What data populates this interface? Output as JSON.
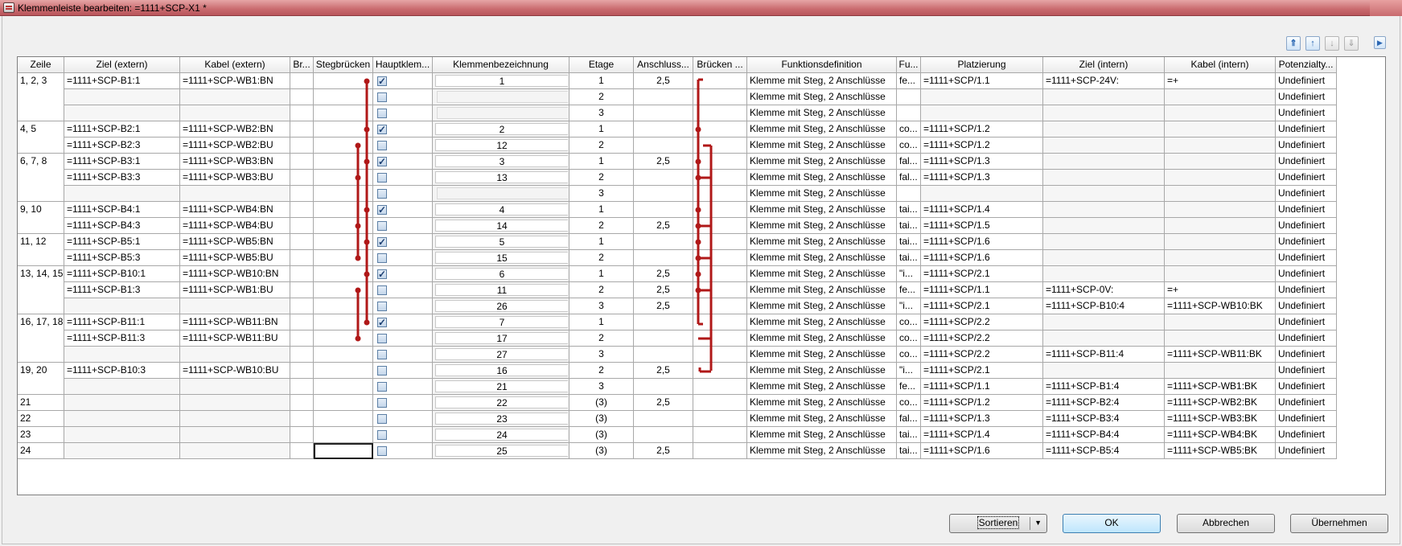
{
  "window": {
    "title": "Klemmenleiste bearbeiten: =1111+SCP-X1 *"
  },
  "nav_buttons": [
    {
      "icon": "move-top-icon",
      "glyph": "⇑"
    },
    {
      "icon": "move-up-icon",
      "glyph": "↑"
    },
    {
      "icon": "move-down-icon",
      "glyph": "↓"
    },
    {
      "icon": "move-bottom-icon",
      "glyph": "⇓"
    },
    {
      "icon": "play-icon",
      "glyph": "▶"
    }
  ],
  "columns": [
    "Zeile",
    "Ziel (extern)",
    "Kabel (extern)",
    "Br...",
    "Stegbrücken",
    "Hauptklem...",
    "Klemmenbezeichnung",
    "Etage",
    "Anschluss...",
    "Brücken ...",
    "Funktionsdefinition",
    "Fu...",
    "Platzierung",
    "Ziel (intern)",
    "Kabel (intern)",
    "Potenzialty..."
  ],
  "zeile_groups": [
    {
      "label": "1, 2, 3",
      "rows": 3
    },
    {
      "label": "4, 5",
      "rows": 2
    },
    {
      "label": "6, 7, 8",
      "rows": 3
    },
    {
      "label": "9, 10",
      "rows": 2
    },
    {
      "label": "11, 12",
      "rows": 2
    },
    {
      "label": "13, 14, 15",
      "rows": 3
    },
    {
      "label": "16, 17, 18",
      "rows": 3
    },
    {
      "label": "19, 20",
      "rows": 2
    },
    {
      "label": "21",
      "rows": 1
    },
    {
      "label": "22",
      "rows": 1
    },
    {
      "label": "23",
      "rows": 1
    },
    {
      "label": "24",
      "rows": 1
    }
  ],
  "rows": [
    {
      "ziel_ext": "=1111+SCP-B1:1",
      "kabel_ext": "=1111+SCP-WB1:BN",
      "haupt": true,
      "klemme": "1",
      "etage": "1",
      "anschluss": "2,5",
      "funktion": "Klemme mit Steg, 2 Anschlüsse",
      "fu": "fe...",
      "platz": "=1111+SCP/1.1",
      "ziel_int": "=1111+SCP-24V:",
      "kabel_int": "=+",
      "pot": "Undefiniert"
    },
    {
      "ziel_ext": "",
      "kabel_ext": "",
      "haupt": false,
      "klemme": "",
      "etage": "2",
      "anschluss": "",
      "funktion": "Klemme mit Steg, 2 Anschlüsse",
      "fu": "",
      "platz": "",
      "ziel_int": "",
      "kabel_int": "",
      "pot": "Undefiniert"
    },
    {
      "ziel_ext": "",
      "kabel_ext": "",
      "haupt": false,
      "klemme": "",
      "etage": "3",
      "anschluss": "",
      "funktion": "Klemme mit Steg, 2 Anschlüsse",
      "fu": "",
      "platz": "",
      "ziel_int": "",
      "kabel_int": "",
      "pot": "Undefiniert"
    },
    {
      "ziel_ext": "=1111+SCP-B2:1",
      "kabel_ext": "=1111+SCP-WB2:BN",
      "haupt": true,
      "klemme": "2",
      "etage": "1",
      "anschluss": "",
      "funktion": "Klemme mit Steg, 2 Anschlüsse",
      "fu": "co...",
      "platz": "=1111+SCP/1.2",
      "ziel_int": "",
      "kabel_int": "",
      "pot": "Undefiniert"
    },
    {
      "ziel_ext": "=1111+SCP-B2:3",
      "kabel_ext": "=1111+SCP-WB2:BU",
      "haupt": false,
      "klemme": "12",
      "etage": "2",
      "anschluss": "",
      "funktion": "Klemme mit Steg, 2 Anschlüsse",
      "fu": "co...",
      "platz": "=1111+SCP/1.2",
      "ziel_int": "",
      "kabel_int": "",
      "pot": "Undefiniert"
    },
    {
      "ziel_ext": "=1111+SCP-B3:1",
      "kabel_ext": "=1111+SCP-WB3:BN",
      "haupt": true,
      "klemme": "3",
      "etage": "1",
      "anschluss": "2,5",
      "funktion": "Klemme mit Steg, 2 Anschlüsse",
      "fu": "fal...",
      "platz": "=1111+SCP/1.3",
      "ziel_int": "",
      "kabel_int": "",
      "pot": "Undefiniert"
    },
    {
      "ziel_ext": "=1111+SCP-B3:3",
      "kabel_ext": "=1111+SCP-WB3:BU",
      "haupt": false,
      "klemme": "13",
      "etage": "2",
      "anschluss": "",
      "funktion": "Klemme mit Steg, 2 Anschlüsse",
      "fu": "fal...",
      "platz": "=1111+SCP/1.3",
      "ziel_int": "",
      "kabel_int": "",
      "pot": "Undefiniert"
    },
    {
      "ziel_ext": "",
      "kabel_ext": "",
      "haupt": false,
      "klemme": "",
      "etage": "3",
      "anschluss": "",
      "funktion": "Klemme mit Steg, 2 Anschlüsse",
      "fu": "",
      "platz": "",
      "ziel_int": "",
      "kabel_int": "",
      "pot": "Undefiniert"
    },
    {
      "ziel_ext": "=1111+SCP-B4:1",
      "kabel_ext": "=1111+SCP-WB4:BN",
      "haupt": true,
      "klemme": "4",
      "etage": "1",
      "anschluss": "",
      "funktion": "Klemme mit Steg, 2 Anschlüsse",
      "fu": "tai...",
      "platz": "=1111+SCP/1.4",
      "ziel_int": "",
      "kabel_int": "",
      "pot": "Undefiniert"
    },
    {
      "ziel_ext": "=1111+SCP-B4:3",
      "kabel_ext": "=1111+SCP-WB4:BU",
      "haupt": false,
      "klemme": "14",
      "etage": "2",
      "anschluss": "2,5",
      "funktion": "Klemme mit Steg, 2 Anschlüsse",
      "fu": "tai...",
      "platz": "=1111+SCP/1.5",
      "ziel_int": "",
      "kabel_int": "",
      "pot": "Undefiniert"
    },
    {
      "ziel_ext": "=1111+SCP-B5:1",
      "kabel_ext": "=1111+SCP-WB5:BN",
      "haupt": true,
      "klemme": "5",
      "etage": "1",
      "anschluss": "",
      "funktion": "Klemme mit Steg, 2 Anschlüsse",
      "fu": "tai...",
      "platz": "=1111+SCP/1.6",
      "ziel_int": "",
      "kabel_int": "",
      "pot": "Undefiniert"
    },
    {
      "ziel_ext": "=1111+SCP-B5:3",
      "kabel_ext": "=1111+SCP-WB5:BU",
      "haupt": false,
      "klemme": "15",
      "etage": "2",
      "anschluss": "",
      "funktion": "Klemme mit Steg, 2 Anschlüsse",
      "fu": "tai...",
      "platz": "=1111+SCP/1.6",
      "ziel_int": "",
      "kabel_int": "",
      "pot": "Undefiniert"
    },
    {
      "ziel_ext": "=1111+SCP-B10:1",
      "kabel_ext": "=1111+SCP-WB10:BN",
      "haupt": true,
      "klemme": "6",
      "etage": "1",
      "anschluss": "2,5",
      "funktion": "Klemme mit Steg, 2 Anschlüsse",
      "fu": "\"i...",
      "platz": "=1111+SCP/2.1",
      "ziel_int": "",
      "kabel_int": "",
      "pot": "Undefiniert"
    },
    {
      "ziel_ext": "=1111+SCP-B1:3",
      "kabel_ext": "=1111+SCP-WB1:BU",
      "haupt": false,
      "klemme": "11",
      "etage": "2",
      "anschluss": "2,5",
      "funktion": "Klemme mit Steg, 2 Anschlüsse",
      "fu": "fe...",
      "platz": "=1111+SCP/1.1",
      "ziel_int": "=1111+SCP-0V:",
      "kabel_int": "=+",
      "pot": "Undefiniert"
    },
    {
      "ziel_ext": "",
      "kabel_ext": "",
      "haupt": false,
      "klemme": "26",
      "etage": "3",
      "anschluss": "2,5",
      "funktion": "Klemme mit Steg, 2 Anschlüsse",
      "fu": "\"i...",
      "platz": "=1111+SCP/2.1",
      "ziel_int": "=1111+SCP-B10:4",
      "kabel_int": "=1111+SCP-WB10:BK",
      "pot": "Undefiniert"
    },
    {
      "ziel_ext": "=1111+SCP-B11:1",
      "kabel_ext": "=1111+SCP-WB11:BN",
      "haupt": true,
      "klemme": "7",
      "etage": "1",
      "anschluss": "",
      "funktion": "Klemme mit Steg, 2 Anschlüsse",
      "fu": "co...",
      "platz": "=1111+SCP/2.2",
      "ziel_int": "",
      "kabel_int": "",
      "pot": "Undefiniert"
    },
    {
      "ziel_ext": "=1111+SCP-B11:3",
      "kabel_ext": "=1111+SCP-WB11:BU",
      "haupt": false,
      "klemme": "17",
      "etage": "2",
      "anschluss": "",
      "funktion": "Klemme mit Steg, 2 Anschlüsse",
      "fu": "co...",
      "platz": "=1111+SCP/2.2",
      "ziel_int": "",
      "kabel_int": "",
      "pot": "Undefiniert"
    },
    {
      "ziel_ext": "",
      "kabel_ext": "",
      "haupt": false,
      "klemme": "27",
      "etage": "3",
      "anschluss": "",
      "funktion": "Klemme mit Steg, 2 Anschlüsse",
      "fu": "co...",
      "platz": "=1111+SCP/2.2",
      "ziel_int": "=1111+SCP-B11:4",
      "kabel_int": "=1111+SCP-WB11:BK",
      "pot": "Undefiniert"
    },
    {
      "ziel_ext": "=1111+SCP-B10:3",
      "kabel_ext": "=1111+SCP-WB10:BU",
      "haupt": false,
      "klemme": "16",
      "etage": "2",
      "anschluss": "2,5",
      "funktion": "Klemme mit Steg, 2 Anschlüsse",
      "fu": "\"i...",
      "platz": "=1111+SCP/2.1",
      "ziel_int": "",
      "kabel_int": "",
      "pot": "Undefiniert"
    },
    {
      "ziel_ext": "",
      "kabel_ext": "",
      "haupt": false,
      "klemme": "21",
      "etage": "3",
      "anschluss": "",
      "funktion": "Klemme mit Steg, 2 Anschlüsse",
      "fu": "fe...",
      "platz": "=1111+SCP/1.1",
      "ziel_int": "=1111+SCP-B1:4",
      "kabel_int": "=1111+SCP-WB1:BK",
      "pot": "Undefiniert"
    },
    {
      "ziel_ext": "",
      "kabel_ext": "",
      "haupt": false,
      "klemme": "22",
      "etage": "(3)",
      "anschluss": "2,5",
      "funktion": "Klemme mit Steg, 2 Anschlüsse",
      "fu": "co...",
      "platz": "=1111+SCP/1.2",
      "ziel_int": "=1111+SCP-B2:4",
      "kabel_int": "=1111+SCP-WB2:BK",
      "pot": "Undefiniert"
    },
    {
      "ziel_ext": "",
      "kabel_ext": "",
      "haupt": false,
      "klemme": "23",
      "etage": "(3)",
      "anschluss": "",
      "funktion": "Klemme mit Steg, 2 Anschlüsse",
      "fu": "fal...",
      "platz": "=1111+SCP/1.3",
      "ziel_int": "=1111+SCP-B3:4",
      "kabel_int": "=1111+SCP-WB3:BK",
      "pot": "Undefiniert"
    },
    {
      "ziel_ext": "",
      "kabel_ext": "",
      "haupt": false,
      "klemme": "24",
      "etage": "(3)",
      "anschluss": "",
      "funktion": "Klemme mit Steg, 2 Anschlüsse",
      "fu": "tai...",
      "platz": "=1111+SCP/1.4",
      "ziel_int": "=1111+SCP-B4:4",
      "kabel_int": "=1111+SCP-WB4:BK",
      "pot": "Undefiniert"
    },
    {
      "ziel_ext": "",
      "kabel_ext": "",
      "haupt": false,
      "klemme": "25",
      "etage": "(3)",
      "anschluss": "2,5",
      "funktion": "Klemme mit Steg, 2 Anschlüsse",
      "fu": "tai...",
      "platz": "=1111+SCP/1.6",
      "ziel_int": "=1111+SCP-B5:4",
      "kabel_int": "=1111+SCP-WB5:BK",
      "pot": "Undefiniert"
    }
  ],
  "buttons": {
    "sort": "Sortieren",
    "ok": "OK",
    "cancel": "Abbrechen",
    "apply": "Übernehmen"
  },
  "colors": {
    "bridge": "#b01818",
    "titlebar": "#c96a6e",
    "grey_row": "#f4f4f4"
  }
}
